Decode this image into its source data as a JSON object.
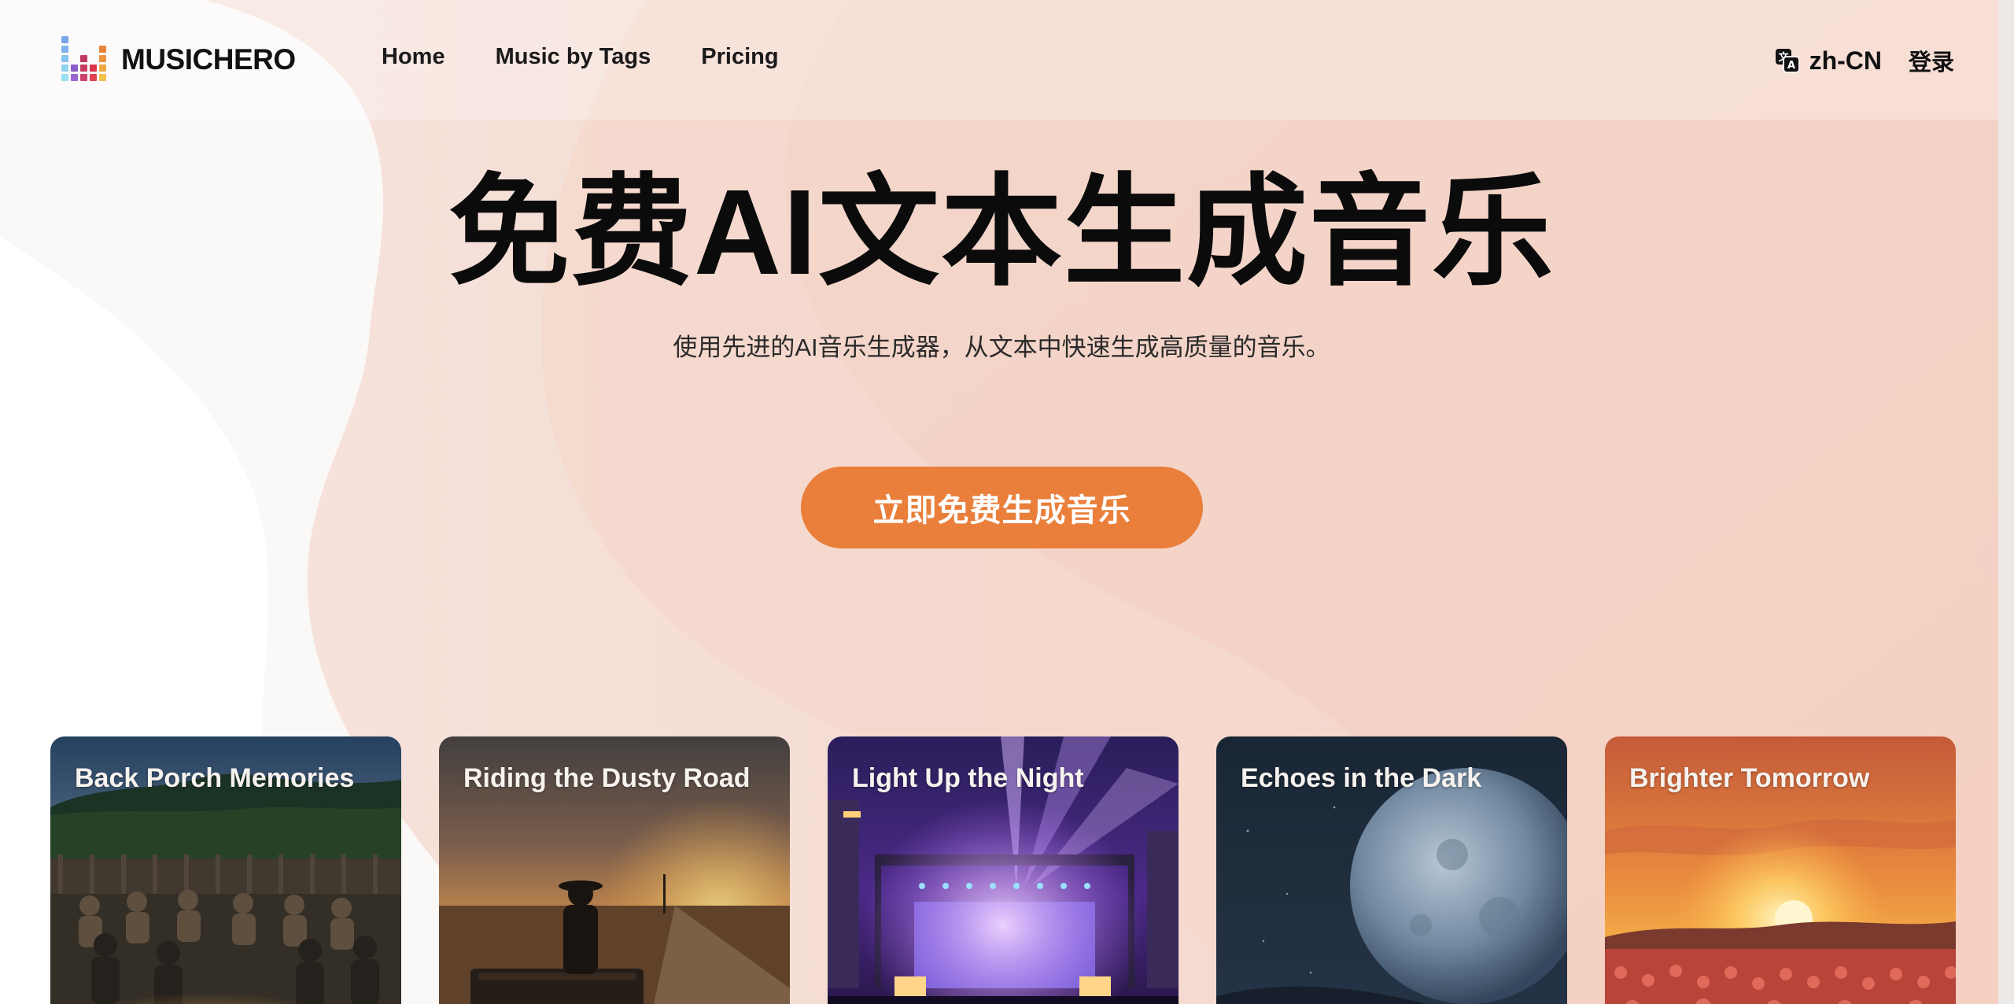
{
  "header": {
    "brand": "MUSICHERO",
    "nav": [
      {
        "label": "Home"
      },
      {
        "label": "Music by Tags"
      },
      {
        "label": "Pricing"
      }
    ],
    "language": "zh-CN",
    "login": "登录"
  },
  "hero": {
    "title": "免费AI文本生成音乐",
    "subtitle": "使用先进的AI音乐生成器，从文本中快速生成高质量的音乐。",
    "cta": "立即免费生成音乐"
  },
  "cards": [
    {
      "title": "Back Porch Memories"
    },
    {
      "title": "Riding the Dusty Road"
    },
    {
      "title": "Light Up the Night"
    },
    {
      "title": "Echoes in the Dark"
    },
    {
      "title": "Brighter Tomorrow"
    }
  ],
  "colors": {
    "accent": "#e97f3b",
    "background_peach": "#f4d5c8"
  }
}
